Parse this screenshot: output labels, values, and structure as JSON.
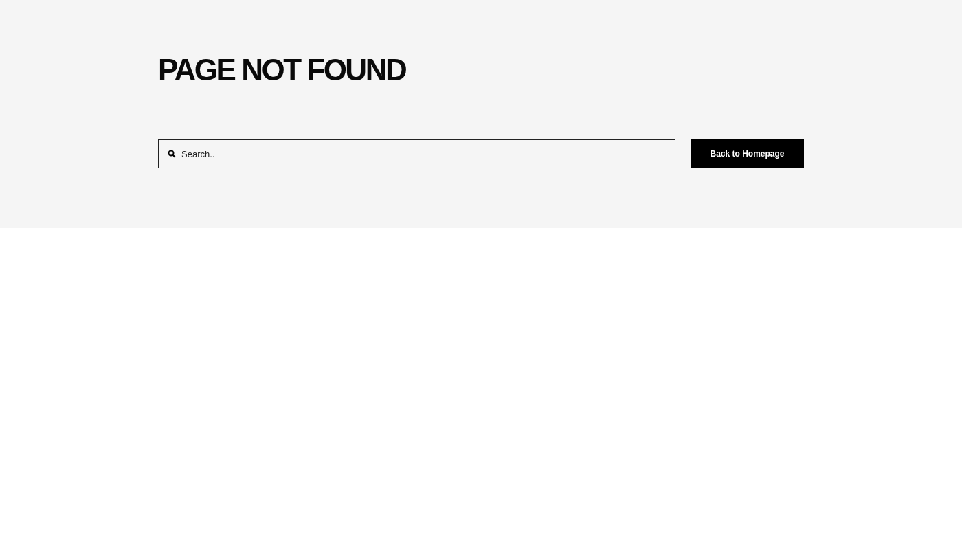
{
  "heading": "PAGE NOT FOUND",
  "search": {
    "placeholder": "Search.."
  },
  "button": {
    "label": "Back to Homepage"
  }
}
